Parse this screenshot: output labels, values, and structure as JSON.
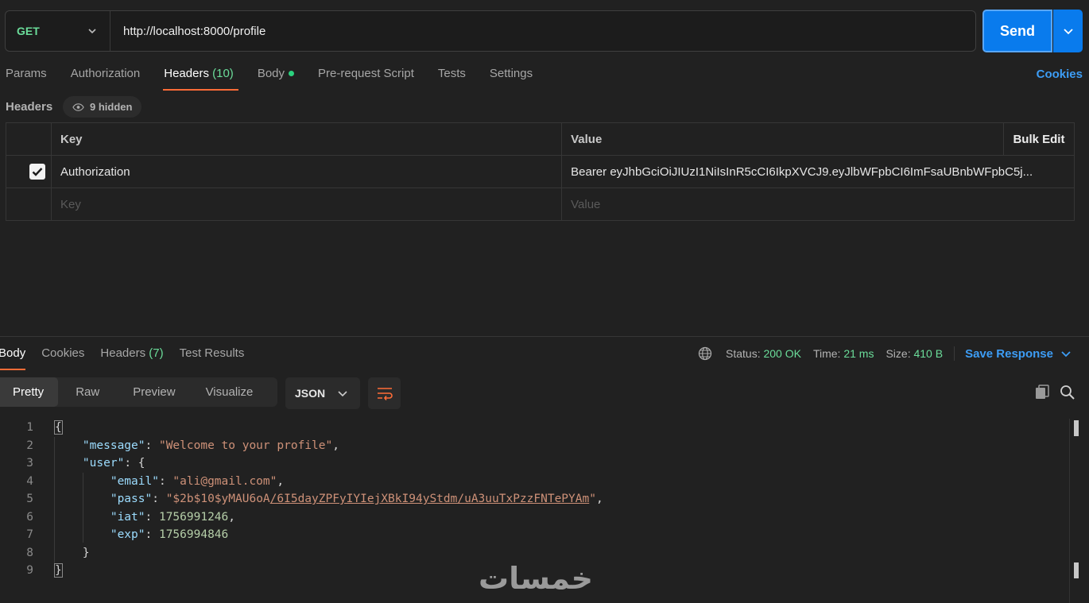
{
  "request": {
    "method": "GET",
    "url": "http://localhost:8000/profile",
    "send_label": "Send"
  },
  "request_tabs": [
    {
      "label": "Params"
    },
    {
      "label": "Authorization"
    },
    {
      "label": "Headers",
      "count": "(10)"
    },
    {
      "label": "Body"
    },
    {
      "label": "Pre-request Script"
    },
    {
      "label": "Tests"
    },
    {
      "label": "Settings"
    }
  ],
  "cookies_link": "Cookies",
  "headers": {
    "section_label": "Headers",
    "hidden_label": "9 hidden",
    "key_col": "Key",
    "value_col": "Value",
    "bulk_edit": "Bulk Edit",
    "rows": [
      {
        "checked": true,
        "key": "Authorization",
        "value": "Bearer eyJhbGciOiJIUzI1NiIsInR5cCI6IkpXVCJ9.eyJlbWFpbCI6ImFsaUBnbWFpbC5j..."
      }
    ],
    "key_placeholder": "Key",
    "value_placeholder": "Value"
  },
  "response_tabs": [
    {
      "label": "Body"
    },
    {
      "label": "Cookies"
    },
    {
      "label": "Headers",
      "count": "(7)"
    },
    {
      "label": "Test Results"
    }
  ],
  "status": {
    "status_label": "Status:",
    "status_value": "200 OK",
    "time_label": "Time:",
    "time_value": "21 ms",
    "size_label": "Size:",
    "size_value": "410 B",
    "save_response": "Save Response"
  },
  "view_modes": [
    "Pretty",
    "Raw",
    "Preview",
    "Visualize"
  ],
  "format": "JSON",
  "response_body": {
    "line_numbers": [
      "1",
      "2",
      "3",
      "4",
      "5",
      "6",
      "7",
      "8",
      "9"
    ],
    "message_key": "\"message\"",
    "message_value": "\"Welcome to your profile\"",
    "user_key": "\"user\"",
    "email_key": "\"email\"",
    "email_value": "\"ali@gmail.com\"",
    "pass_key": "\"pass\"",
    "pass_value_prefix": "\"$2b$10$yMAU6oA",
    "pass_value_link": "/6I5dayZPFyIYIejXBkI94yStdm/uA3uuTxPzzFNTePYAm",
    "pass_value_suffix": "\"",
    "iat_key": "\"iat\"",
    "iat_value": "1756991246",
    "exp_key": "\"exp\"",
    "exp_value": "1756994846"
  },
  "watermark": "خمسات"
}
